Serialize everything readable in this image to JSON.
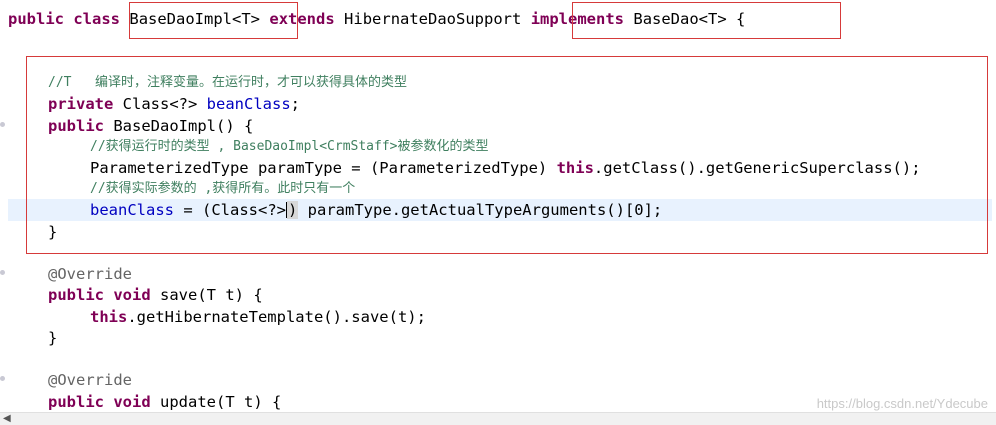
{
  "colors": {
    "keyword": "#7f0055",
    "field": "#0000c0",
    "comment": "#3f7f5f",
    "annotation": "#646464",
    "highlight_box": "#d63a3a",
    "current_line": "#e8f2fe"
  },
  "editor": {
    "line1": {
      "kw_public": "public",
      "kw_class": "class",
      "class_name": "BaseDaoImpl<T>",
      "kw_extends": "extends",
      "super_name": "HibernateDaoSupport",
      "kw_implements": "implements",
      "iface": "BaseDao<T> {"
    },
    "line2": {
      "comment": "//T   编译时，注释变量。在运行时，才可以获得具体的类型"
    },
    "line3": {
      "kw": "private",
      "type": "Class<?>",
      "field": "beanClass",
      "end": ";"
    },
    "line4": {
      "kw": "public",
      "rest": "BaseDaoImpl() {"
    },
    "line5": {
      "comment": "//获得运行时的类型 , BaseDaoImpl<CrmStaff>被参数化的类型"
    },
    "line6": {
      "pre": "ParameterizedType paramType = (ParameterizedType) ",
      "kw": "this",
      "post": ".getClass().getGenericSuperclass();"
    },
    "line7": {
      "comment": "//获得实际参数的 ,获得所有。此时只有一个"
    },
    "line8": {
      "field": "beanClass",
      "mid": " = (Class<?>",
      "post": " paramType.getActualTypeArguments()[0];"
    },
    "line9": {
      "text": "}"
    },
    "line10": {
      "text": "@Override"
    },
    "line11": {
      "kw1": "public",
      "kw2": "void",
      "rest": "save(T t) {"
    },
    "line12": {
      "kw": "this",
      "rest": ".getHibernateTemplate().save(t);"
    },
    "line13": {
      "text": "}"
    },
    "line14": {
      "text": "@Override"
    },
    "line15": {
      "kw1": "public",
      "kw2": "void",
      "rest": "update(T t) {"
    }
  },
  "watermark": "https://blog.csdn.net/Ydecube"
}
